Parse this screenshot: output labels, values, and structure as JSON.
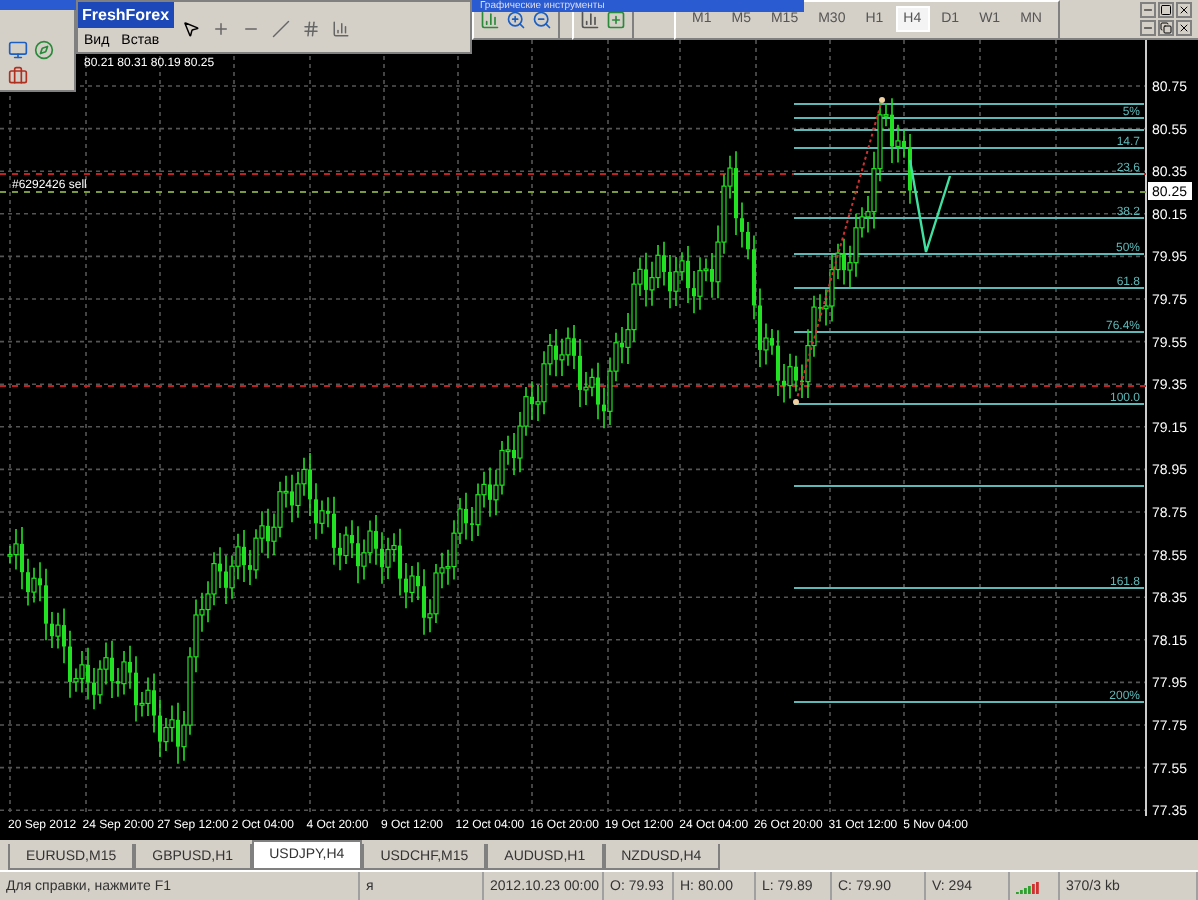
{
  "toolbar_title": "Графические инструменты",
  "floating_window": {
    "title": "FreshForex",
    "menu": [
      "Вид",
      "Встав"
    ]
  },
  "timeframes": [
    {
      "label": "M1",
      "selected": false
    },
    {
      "label": "M5",
      "selected": false
    },
    {
      "label": "M15",
      "selected": false
    },
    {
      "label": "M30",
      "selected": false
    },
    {
      "label": "H1",
      "selected": false
    },
    {
      "label": "H4",
      "selected": true
    },
    {
      "label": "D1",
      "selected": false
    },
    {
      "label": "W1",
      "selected": false
    },
    {
      "label": "MN",
      "selected": false
    }
  ],
  "chart": {
    "ohlc_label": "80.21 80.31 80.19 80.25",
    "order_label": "#6292426 sell",
    "current_price": "80.25",
    "price_ticks": [
      "80.75",
      "80.55",
      "80.35",
      "80.15",
      "79.95",
      "79.75",
      "79.55",
      "79.35",
      "79.15",
      "78.95",
      "78.75",
      "78.55",
      "78.35",
      "78.15",
      "77.95",
      "77.75",
      "77.55",
      "77.35"
    ],
    "fib_levels": [
      "5%",
      "14.7",
      "23.6",
      "38.2",
      "50%",
      "61.8",
      "76.4%",
      "100.0",
      "161.8",
      "200%"
    ],
    "time_ticks": [
      "20 Sep 2012",
      "24 Sep 20:00",
      "27 Sep 12:00",
      "2 Oct 04:00",
      "4 Oct 20:00",
      "9 Oct 12:00",
      "12 Oct 04:00",
      "16 Oct 20:00",
      "19 Oct 12:00",
      "24 Oct 04:00",
      "26 Oct 20:00",
      "31 Oct 12:00",
      "5 Nov 04:00"
    ]
  },
  "tabs": [
    {
      "label": "EURUSD,M15",
      "selected": false
    },
    {
      "label": "GBPUSD,H1",
      "selected": false
    },
    {
      "label": "USDJPY,H4",
      "selected": true
    },
    {
      "label": "USDCHF,M15",
      "selected": false
    },
    {
      "label": "AUDUSD,H1",
      "selected": false
    },
    {
      "label": "NZDUSD,H4",
      "selected": false
    }
  ],
  "status_bar": {
    "help": "Для справки, нажмите F1",
    "profile": "я",
    "time": "2012.10.23 00:00",
    "open": "O: 79.93",
    "high": "H: 80.00",
    "low": "L: 79.89",
    "close": "C: 79.90",
    "volume": "V: 294",
    "traffic": "370/3 kb"
  }
}
